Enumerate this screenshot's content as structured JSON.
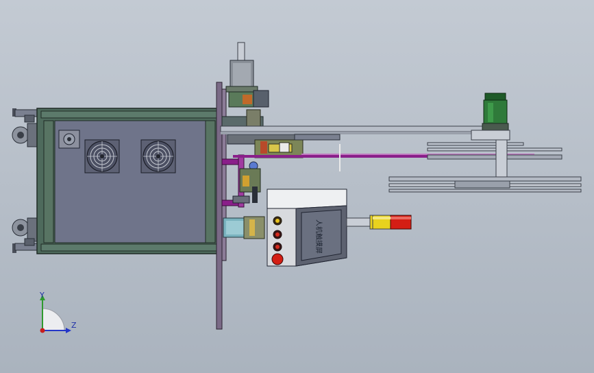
{
  "viewport": {
    "background_top": "#c3cad3",
    "background_bottom": "#aab3be"
  },
  "triad": {
    "y_label": "Y",
    "z_label": "Z",
    "y_color": "#2e9a2e",
    "z_color": "#2436c8",
    "x_color": "#c81e1e"
  },
  "control_panel": {
    "label": "人机触摸屏",
    "buttons": [
      "yellow-button",
      "red-button",
      "red-button",
      "red-emergency-stop"
    ]
  },
  "colors": {
    "cabinet": "#4e6a5c",
    "cabinet_panel": "#6f748a",
    "motor": "#2f7a3a",
    "purple_bar": "#8a1f8a",
    "signal_yellow": "#e8d21e",
    "signal_red": "#d41e14",
    "teal_shaft": "#7ab3bf"
  }
}
